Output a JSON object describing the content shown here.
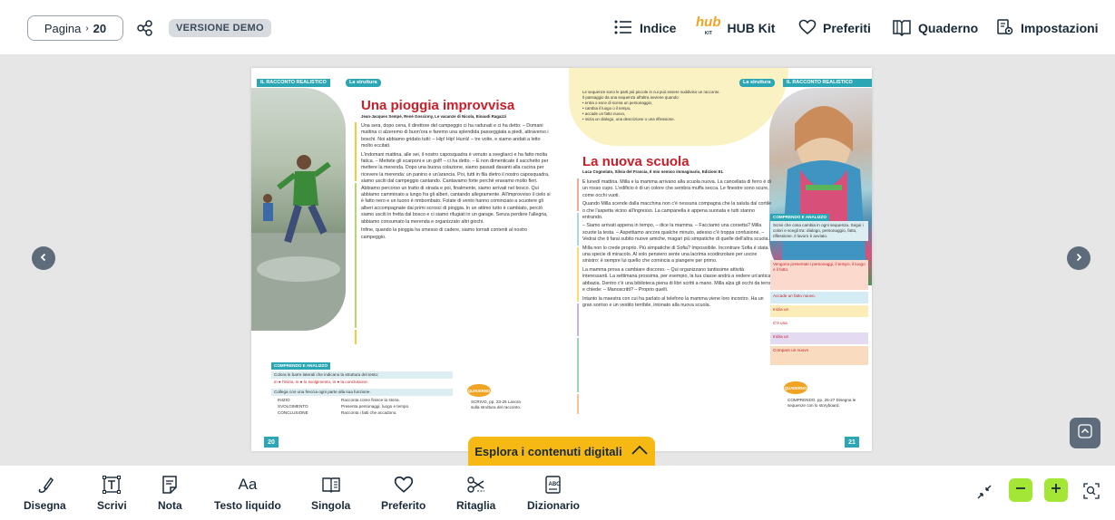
{
  "topbar": {
    "page_label": "Pagina",
    "page_number": "20",
    "demo_badge": "VERSIONE DEMO",
    "nav": [
      {
        "label": "Indice",
        "icon": "list-icon"
      },
      {
        "label": "HUB Kit",
        "icon": "hub-kit-logo"
      },
      {
        "label": "Preferiti",
        "icon": "heart-icon"
      },
      {
        "label": "Quaderno",
        "icon": "book-icon"
      },
      {
        "label": "Impostazioni",
        "icon": "settings-icon"
      }
    ]
  },
  "book": {
    "left": {
      "tag_section": "IL RACCONTO REALISTICO",
      "tag_topic": "La struttura",
      "title": "Una pioggia improvvisa",
      "byline": "Jean-Jacques Sempé, René Goscinny, Le vacanze di Nicola, Einaudi Ragazzi",
      "paragraphs": [
        "Una sera, dopo cena, il direttore del campeggio ci ha radunati e ci ha detto: – Domani mattina ci alzeremo di buon'ora e faremo una splendida passeggiata a piedi, attraverso i boschi. Noi abbiamo gridato tutti: – Hip! Hip! Hurrà! – tre volte, e siamo andati a letto molto eccitati.",
        "L'indomani mattina, alle sei, il nostro caposquadra è venuto a svegliarci e ha fatto molta fatica. – Mettete gli scarponi e un golf! – ci ha detto. – E non dimenticate il sacchetto per mettere la merenda. Dopo una buona colazione, siamo passati davanti alla cucina per ricevere la merenda: un panino e un'arancia. Poi, tutti in fila dietro il nostro caposquadra, siamo usciti dal campeggio cantando. Cantavamo forte perché eravamo molto fieri. Abbiamo percorso un tratto di strada e poi, finalmente, siamo arrivati nel bosco. Qui abbiamo camminato a lungo fra gli alberi, cantando allegramente. All'improvviso il cielo si è fatto nero e un tuono è rimbombato. Folate di vento hanno cominciato a scuotere gli alberi accompagnate dai primi scrosci di pioggia. In un attimo tutto è cambiato, perciò siamo usciti in fretta dal bosco e ci siamo rifugiati in un garage. Senza perdere l'allegria, abbiamo consumato la merenda e organizzato altri giochi.",
        "Infine, quando la pioggia ha smesso di cadere, siamo tornati contenti al nostro campeggio."
      ],
      "exercise_head": "COMPRENDO E ANALIZZO",
      "exercise_1": "Colora le barre laterali che indicano la struttura del testo:",
      "exercise_1b": "in ● l'inizio, in ● lo svolgimento, in ● la conclusione.",
      "exercise_2": "Collega con una freccia ogni parte alla sua funzione.",
      "match_rows": [
        {
          "part": "INIZIO",
          "function": "Racconta come finisce la storia."
        },
        {
          "part": "SVOLGIMENTO",
          "function": "Presenta personaggi, luogo e tempo."
        },
        {
          "part": "CONCLUSIONE",
          "function": "Racconta i fatti che accadono."
        }
      ],
      "quaderno_badge": "QUADERNO",
      "quaderno_text": "SCRIVO, pp. 23-25 Lavora sulla struttura del racconto.",
      "page_number": "20"
    },
    "right": {
      "tag_topic": "La struttura",
      "tag_section": "IL RACCONTO REALISTICO",
      "intro_lines": [
        "Le sequenze sono le parti più piccole in cui può essere suddiviso un racconto.",
        "Il passaggio da una sequenza all'altra avviene quando:",
        "• entra o esce di scena un personaggio,",
        "• cambia il luogo o il tempo,",
        "• accade un fatto nuovo,",
        "• inizia un dialogo, una descrizione o una riflessione."
      ],
      "title": "La nuova scuola",
      "byline": "Luca Cognolato, Silvia del Francia, Il mio nemico immaginario, Edizioni EL",
      "paragraphs": [
        "È lunedì mattina. Milla e la mamma arrivano alla scuola nuova. La cancellata di ferro è di un rosso cupo. L'edificio è di un colore che sembra muffa secca. Le finestre sono scure, come occhi vuoti.",
        "Quando Milla scende dalla macchina non c'è nessuna compagna che la saluta dal cortile o che l'aspetta vicino all'ingresso. La campanella è appena suonata e tutti stanno entrando.",
        "– Siamo arrivati appena in tempo, – dice la mamma. – Facciamo una corsetta? Milla scuote la testa. – Aspettiamo ancora qualche minuto, adesso c'è troppa confusione. – Vedrai che ti farai subito nuove amiche, magari più simpatiche di quelle dell'altra scuola.",
        "Milla non lo crede proprio. Più simpatiche di Sofia? Impossibile. Incontrare Sofia è stata una specie di miracolo. Al solo pensiero sente una lacrima scodinzolare per uscire sinistro: è sempre lui quello che comincia a piangere per primo.",
        "La mamma prova a cambiare discorso. – Qui organizzano tantissime attività interessanti. La settimana prossima, per esempio, la tua classe andrà a vedere un'antica abbazia. Dentro c'è una biblioteca piena di libri scritti a mano. Milla alza gli occhi da terra e chiede: – Manoscritti? – Proprio quelli.",
        "Intanto la maestra con cui ha parlato al telefono la mamma viene loro incontro. Ha un gran sorriso e un vestito terribile, intonato alla nuova scuola."
      ],
      "exercise_head": "COMPRENDO E ANALIZZO",
      "exercise_text": "Scrivi che cosa cambia in ogni sequenza. Segui i colori e scegli tra: dialogo, personaggio, fatto, riflessione. Il lavoro è avviato.",
      "side_boxes": [
        "Vengono presentati i personaggi, il tempo, il luogo e il fatto.",
        "Accade un fatto nuovo.",
        "Inizia un",
        "C'è una",
        "Inizia un",
        "Compare un nuovo"
      ],
      "quaderno_badge": "QUADERNO",
      "quaderno_text": "COMPRENDO, pp. 26-27 Disegna le sequenze con lo storyboard.",
      "page_number": "21"
    }
  },
  "explore_button": "Esplora i contenuti digitali",
  "toolbar": [
    {
      "label": "Disegna",
      "icon": "pen-icon"
    },
    {
      "label": "Scrivi",
      "icon": "text-box-icon"
    },
    {
      "label": "Nota",
      "icon": "note-icon"
    },
    {
      "label": "Testo liquido",
      "icon": "font-size-icon"
    },
    {
      "label": "Singola",
      "icon": "single-page-icon"
    },
    {
      "label": "Preferito",
      "icon": "heart-icon"
    },
    {
      "label": "Ritaglia",
      "icon": "scissors-icon"
    },
    {
      "label": "Dizionario",
      "icon": "dictionary-icon"
    }
  ],
  "colors": {
    "accent_green": "#a3e635",
    "explore_yellow": "#f6b914",
    "teal": "#2aa6b5",
    "title_red": "#c7202a",
    "dark_button": "#5d6b7a"
  }
}
